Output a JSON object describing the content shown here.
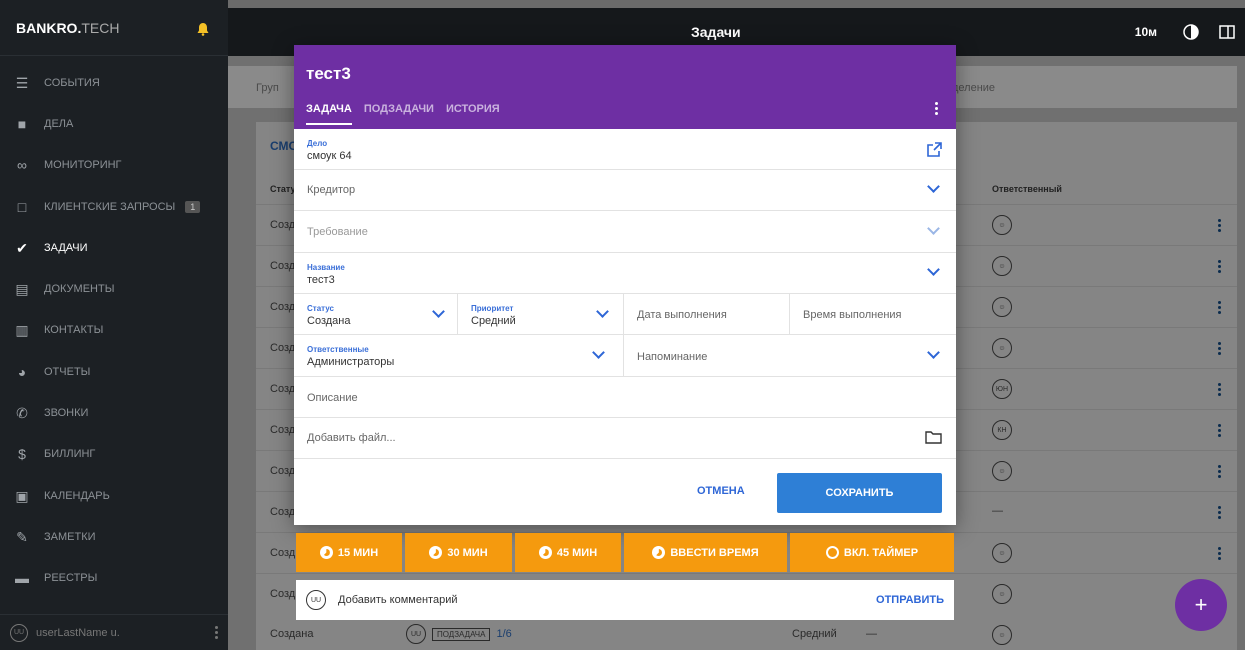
{
  "app": {
    "brand_bold": "BANKRO.",
    "brand_light": "TECH",
    "page_title": "Задачи",
    "timer": "10м"
  },
  "sidebar": {
    "items": [
      {
        "label": "СОБЫТИЯ",
        "icon": "events-icon"
      },
      {
        "label": "ДЕЛА",
        "icon": "briefcase-icon"
      },
      {
        "label": "МОНИТОРИНГ",
        "icon": "binoculars-icon"
      },
      {
        "label": "КЛИЕНТСКИЕ ЗАПРОСЫ",
        "icon": "inbox-icon",
        "badge": "1"
      },
      {
        "label": "ЗАДАЧИ",
        "icon": "clipboard-check-icon",
        "active": true
      },
      {
        "label": "ДОКУМЕНТЫ",
        "icon": "document-icon"
      },
      {
        "label": "КОНТАКТЫ",
        "icon": "book-icon"
      },
      {
        "label": "ОТЧЕТЫ",
        "icon": "pie-chart-icon"
      },
      {
        "label": "ЗВОНКИ",
        "icon": "phone-icon"
      },
      {
        "label": "БИЛЛИНГ",
        "icon": "dollar-icon"
      },
      {
        "label": "КАЛЕНДАРЬ",
        "icon": "calendar-icon"
      },
      {
        "label": "ЗАМЕТКИ",
        "icon": "pencil-icon"
      },
      {
        "label": "РЕЕСТРЫ",
        "icon": "registry-icon"
      }
    ],
    "user_initials": "UU",
    "user_name": "userLastName u."
  },
  "background": {
    "crumb_left": "Груп",
    "crumb_right": "деление",
    "card_title": "СМС",
    "col_status": "Стату",
    "col_responsible": "Ответственный",
    "rows": [
      {
        "status": "Созд",
        "resp": "avatar-group"
      },
      {
        "status": "Созд",
        "resp": "avatar-group"
      },
      {
        "status": "Созд",
        "resp": "avatar-group"
      },
      {
        "status": "Созд",
        "resp": "avatar-group"
      },
      {
        "status": "Созд",
        "resp": "ЮН"
      },
      {
        "status": "Созд",
        "resp": "КН"
      },
      {
        "status": "Созд",
        "resp": "avatar-group"
      },
      {
        "status": "Созд",
        "resp": "—"
      },
      {
        "status": "Созд",
        "resp": "avatar-group"
      },
      {
        "status": "Созд",
        "resp": "avatar-group"
      }
    ],
    "last_row": {
      "status": "Создана",
      "initials": "UU",
      "tag": "ПОДЗАДАЧА",
      "count": "1/6",
      "priority": "Средний",
      "dash": "—"
    }
  },
  "modal": {
    "title": "тест3",
    "tabs": [
      "ЗАДАЧА",
      "ПОДЗАДАЧИ",
      "ИСТОРИЯ"
    ],
    "case_label": "Дело",
    "case_value": "смоук 64",
    "creditor_placeholder": "Кредитор",
    "claim_placeholder": "Требование",
    "name_label": "Название",
    "name_value": "тест3",
    "status_label": "Статус",
    "status_value": "Создана",
    "priority_label": "Приоритет",
    "priority_value": "Средний",
    "due_date_placeholder": "Дата выполнения",
    "due_time_placeholder": "Время выполнения",
    "responsible_label": "Ответственные",
    "responsible_value": "Администраторы",
    "reminder_placeholder": "Напоминание",
    "description_placeholder": "Описание",
    "attach_placeholder": "Добавить файл...",
    "cancel_label": "ОТМЕНА",
    "save_label": "СОХРАНИТЬ"
  },
  "timers": {
    "t15": "15 МИН",
    "t30": "30 МИН",
    "t45": "45 МИН",
    "enter": "ВВЕСТИ ВРЕМЯ",
    "start": "ВКЛ. ТАЙМЕР"
  },
  "comment": {
    "initials": "UU",
    "placeholder": "Добавить комментарий",
    "send": "ОТПРАВИТЬ"
  },
  "fab": {
    "label": "+"
  },
  "colors": {
    "accent_purple": "#6e2fa3",
    "primary_blue": "#2e7fd6",
    "timer_orange": "#f59a0e",
    "sidebar_bg": "#1c2024"
  }
}
